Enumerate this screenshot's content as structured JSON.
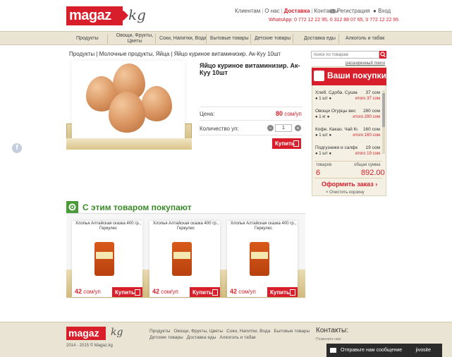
{
  "header": {
    "logo": "magaz",
    "logo_suffix": "kg",
    "nav": [
      "Клиентам",
      "О нас",
      "Доставка",
      "Контакты"
    ],
    "register": "Регистрация",
    "login": "Вход",
    "phones": "WhatsApp: 0 772 12 22 95,  0 312 88 07 65,  0 772 12 22 95"
  },
  "categories": [
    "Продукты",
    "Овощи, Фрукты,\nЦветы",
    "Соки, Напитки, Вода",
    "Бытовые товары",
    "Детские товары",
    "Доставка еды",
    "Алкоголь и табак"
  ],
  "breadcrumbs": "Продукты   |   Молочные продукты, Яйца   |   Яйцо куриное витаминизир. Ак-Куу 10шт",
  "search": {
    "placeholder": "поиск по товарам",
    "advanced": "расширенный поиск"
  },
  "product": {
    "title": "Яйцо куриное витаминизир. Ак-Куу 10шт",
    "price_label": "Цена:",
    "price_value": "80",
    "price_unit": "сом/уп",
    "qty_label": "Количество уп:",
    "qty_value": "1",
    "buy": "Купить"
  },
  "cart": {
    "title": "Ваши покупки",
    "items": [
      {
        "name": "Хлеб. Сдоба. Сушки ...",
        "price": "37 сом",
        "qty": "1 шт",
        "total": "итого 37 сом"
      },
      {
        "name": "Овощи Огурцы вес",
        "price": "280 сом",
        "qty": "1 кг",
        "total": "итого 280 сом"
      },
      {
        "name": "Кофе. Какао. Чай Ко...",
        "price": "160 сом",
        "qty": "1 шт",
        "total": "итого 160 сом"
      },
      {
        "name": "Подгузники и салфет...",
        "price": "19 сом",
        "qty": "1 шт",
        "total": "итого 19 сом"
      }
    ],
    "count_label": "товаров",
    "count_value": "6",
    "sum_label": "общая сумма",
    "sum_value": "892.00",
    "checkout": "Оформить заказ ›",
    "clear": "× Очистить корзину"
  },
  "also": {
    "title": "С этим товаром покупают",
    "items": [
      {
        "name": "Хлопья Алтайская сказка 400 гр., Геркулес",
        "price": "42",
        "unit": "сом/уп",
        "buy": "Купить"
      },
      {
        "name": "Хлопья Алтайская сказка 400 гр., Геркулес",
        "price": "42",
        "unit": "сом/уп",
        "buy": "Купить"
      },
      {
        "name": "Хлопья Алтайская сказка 400 гр., Геркулес",
        "price": "42",
        "unit": "сом/уп",
        "buy": "Купить"
      }
    ]
  },
  "footer": {
    "logo": "magaz",
    "logo_suffix": "kg",
    "copyright": "2014 - 2015 © Magaz.kg",
    "links": [
      "Продукты",
      "Овощи, Фрукты, Цветы",
      "Соки, Напитки, Вода",
      "Бытовые товары",
      "Детские товары",
      "Доставка еды",
      "Алкоголь и табак"
    ],
    "contacts": "Контакты:",
    "contacts_small": "Позвоните нам:"
  },
  "chat": {
    "label": "Отправьте нам сообщение",
    "brand": "jivosite"
  },
  "social": {
    "fb": "f"
  },
  "colors": {
    "accent": "#d81e2a",
    "green": "#3a8a2a",
    "beige": "#e9e4d3"
  }
}
